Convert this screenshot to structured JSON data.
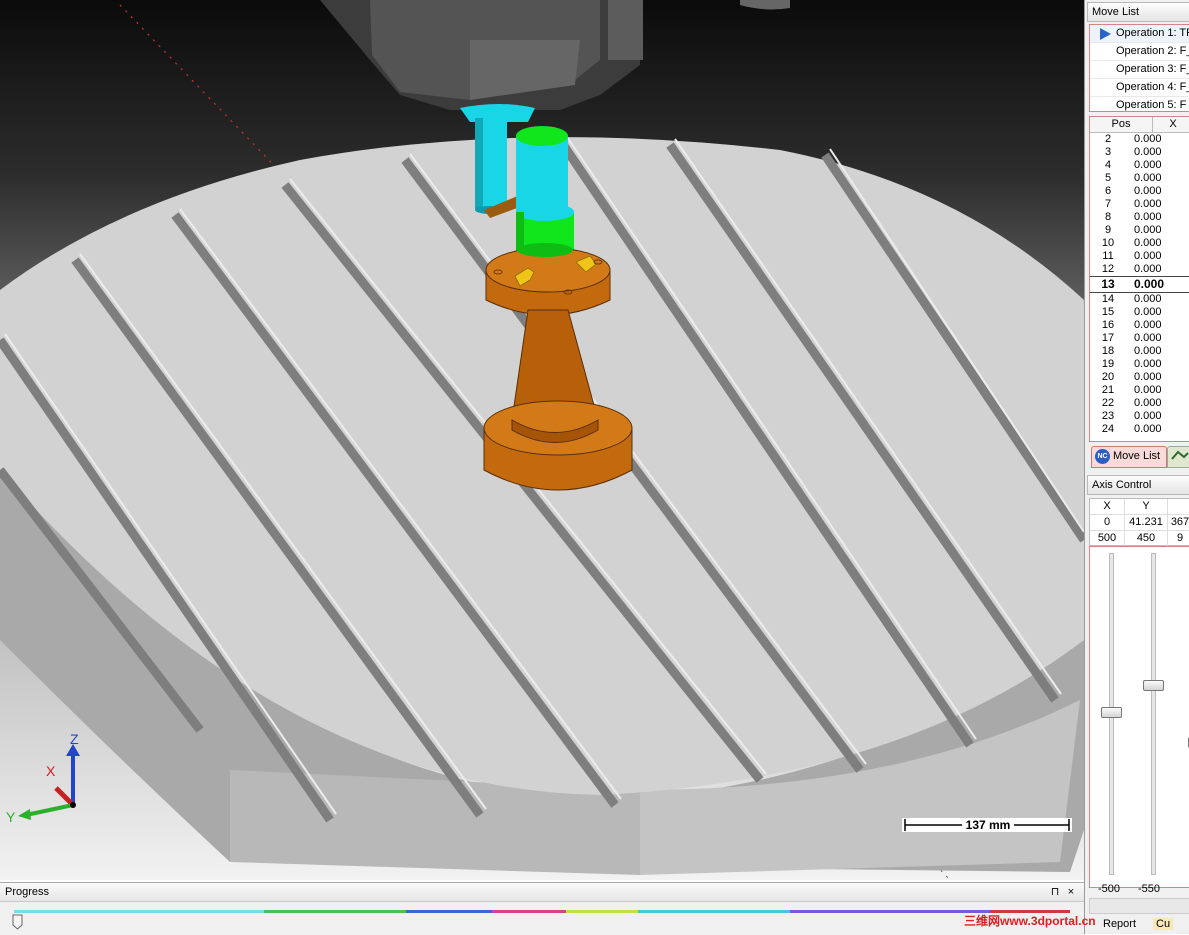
{
  "viewport": {
    "scale_label": "137 mm",
    "triad": {
      "x": "X",
      "y": "Y",
      "z": "Z"
    }
  },
  "move_list": {
    "title": "Move List",
    "operations": [
      "Operation 1: TR",
      "Operation 2: F_",
      "Operation 3: F_",
      "Operation 4: F_",
      "Operation 5: F"
    ],
    "columns": [
      "Pos",
      "X"
    ],
    "rows": [
      [
        "2",
        "0.000"
      ],
      [
        "3",
        "0.000"
      ],
      [
        "4",
        "0.000"
      ],
      [
        "5",
        "0.000"
      ],
      [
        "6",
        "0.000"
      ],
      [
        "7",
        "0.000"
      ],
      [
        "8",
        "0.000"
      ],
      [
        "9",
        "0.000"
      ],
      [
        "10",
        "0.000"
      ],
      [
        "11",
        "0.000"
      ],
      [
        "12",
        "0.000"
      ],
      [
        "13",
        "0.000"
      ],
      [
        "14",
        "0.000"
      ],
      [
        "15",
        "0.000"
      ],
      [
        "16",
        "0.000"
      ],
      [
        "17",
        "0.000"
      ],
      [
        "18",
        "0.000"
      ],
      [
        "19",
        "0.000"
      ],
      [
        "20",
        "0.000"
      ],
      [
        "21",
        "0.000"
      ],
      [
        "22",
        "0.000"
      ],
      [
        "23",
        "0.000"
      ],
      [
        "24",
        "0.000"
      ]
    ],
    "current_row": "13",
    "tab_label": "Move List",
    "tab_badge": "NC"
  },
  "axis_control": {
    "title": "Axis Control",
    "headers": [
      "X",
      "Y",
      ""
    ],
    "current": [
      "0",
      "41.231",
      "367"
    ],
    "max": [
      "500",
      "450",
      "9"
    ],
    "min": [
      "-500",
      "-550"
    ],
    "bottom_tabs": [
      "Report",
      "Cu"
    ]
  },
  "progress": {
    "title": "Progress",
    "pin": "⊓",
    "close": "×"
  },
  "watermark": "三维网www.3dportal.cn",
  "colors": {
    "part": "#c46a0e",
    "stock_green": "#11e51b",
    "tool_cyan": "#19d6e6",
    "table": "#d2d2d2",
    "accent": "#2a63c8"
  }
}
